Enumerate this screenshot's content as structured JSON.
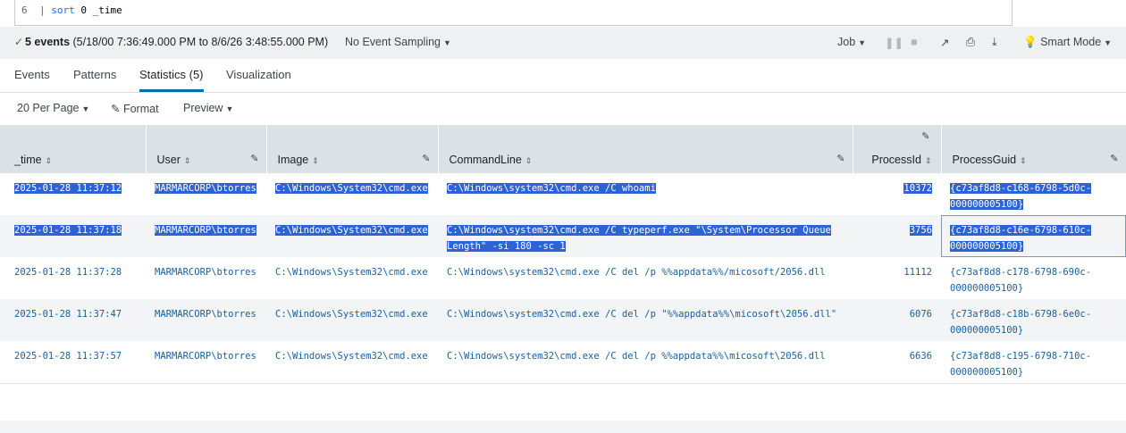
{
  "search": {
    "line_number": "6",
    "pipe": "|",
    "command": "sort",
    "args": " 0 _time"
  },
  "status": {
    "check": "✓",
    "event_count": "5 events",
    "range": "(5/18/00 7:36:49.000 PM to 8/6/26 3:48:55.000 PM)",
    "sampling": "No Event Sampling",
    "job": "Job",
    "smart_mode": "Smart Mode"
  },
  "tabs": [
    "Events",
    "Patterns",
    "Statistics (5)",
    "Visualization"
  ],
  "toolbar": {
    "per_page": "20 Per Page",
    "format": "Format",
    "preview": "Preview"
  },
  "columns": [
    "_time",
    "User",
    "Image",
    "CommandLine",
    "ProcessId",
    "ProcessGuid"
  ],
  "rows": [
    {
      "time": "2025-01-28 11:37:12",
      "user": "MARMARCORP\\btorres",
      "image": "C:\\Windows\\System32\\cmd.exe",
      "cmd": "C:\\Windows\\system32\\cmd.exe /C whoami",
      "cmd2": "",
      "pid": "10372",
      "guid": "{c73af8d8-c168-6798-5d0c-",
      "guid2": "000000005100}"
    },
    {
      "time": "2025-01-28 11:37:18",
      "user": "MARMARCORP\\btorres",
      "image": "C:\\Windows\\System32\\cmd.exe",
      "cmd": "C:\\Windows\\system32\\cmd.exe /C typeperf.exe \"\\System\\Processor Queue",
      "cmd2": "Length\" -si 180 -sc 1",
      "pid": "3756",
      "guid": "{c73af8d8-c16e-6798-610c-",
      "guid2": "000000005100}"
    },
    {
      "time": "2025-01-28 11:37:28",
      "user": "MARMARCORP\\btorres",
      "image": "C:\\Windows\\System32\\cmd.exe",
      "cmd": "C:\\Windows\\system32\\cmd.exe /C del /p %%appdata%%/micosoft/2056.dll",
      "cmd2": "",
      "pid": "11112",
      "guid": "{c73af8d8-c178-6798-690c-",
      "guid2": "000000005100}"
    },
    {
      "time": "2025-01-28 11:37:47",
      "user": "MARMARCORP\\btorres",
      "image": "C:\\Windows\\System32\\cmd.exe",
      "cmd": "C:\\Windows\\system32\\cmd.exe /C del /p \"%%appdata%%\\micosoft\\2056.dll\"",
      "cmd2": "",
      "pid": "6076",
      "guid": "{c73af8d8-c18b-6798-6e0c-",
      "guid2": "000000005100}"
    },
    {
      "time": "2025-01-28 11:37:57",
      "user": "MARMARCORP\\btorres",
      "image": "C:\\Windows\\System32\\cmd.exe",
      "cmd": "C:\\Windows\\system32\\cmd.exe /C del /p %%appdata%%\\micosoft\\2056.dll",
      "cmd2": "",
      "pid": "6636",
      "guid": "{c73af8d8-c195-6798-710c-",
      "guid2": "000000005100}"
    }
  ],
  "colors": {
    "link": "#1a5e9c",
    "selection": "#2d63d4",
    "header_bg": "#dce1e7",
    "active_tab": "#006eaa"
  }
}
